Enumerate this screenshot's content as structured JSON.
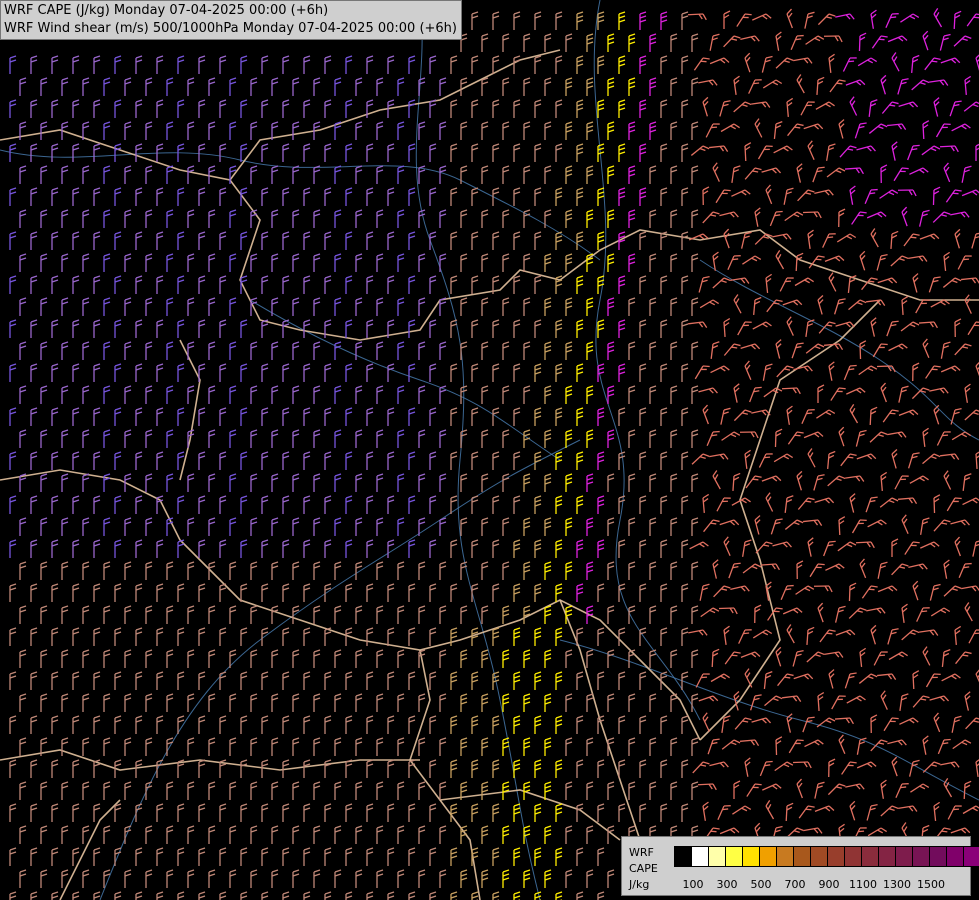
{
  "title": {
    "line1": "WRF CAPE (J/kg) Monday 07-04-2025 00:00 (+6h)",
    "line2": "WRF Wind shear (m/s) 500/1000hPa Monday 07-04-2025 00:00 (+6h)"
  },
  "legend": {
    "label1": "WRF",
    "label2": "CAPE",
    "label3": "J/kg",
    "colors": [
      "#000000",
      "#ffffff",
      "#ffffaa",
      "#ffff44",
      "#ffe100",
      "#f0a000",
      "#c87a20",
      "#a8581c",
      "#a04a24",
      "#983e2c",
      "#903434",
      "#8a2c3c",
      "#842444",
      "#7e1c4c",
      "#781454",
      "#720c5c",
      "#80006a",
      "#8a0078"
    ],
    "ticks": [
      "100",
      "300",
      "500",
      "700",
      "900",
      "1100",
      "1300",
      "1500"
    ]
  },
  "map": {
    "barb_colors": {
      "low_cape": "#c08878",
      "purple": "#9966cc",
      "violet": "#7755dd",
      "yellow": "#ffee00",
      "tan": "#c8a060",
      "magenta": "#dd22dd",
      "salmon": "#e07060",
      "pink": "#cc4488"
    },
    "border_color": "#e6c3a0",
    "river_color": "#4a7fb5"
  }
}
